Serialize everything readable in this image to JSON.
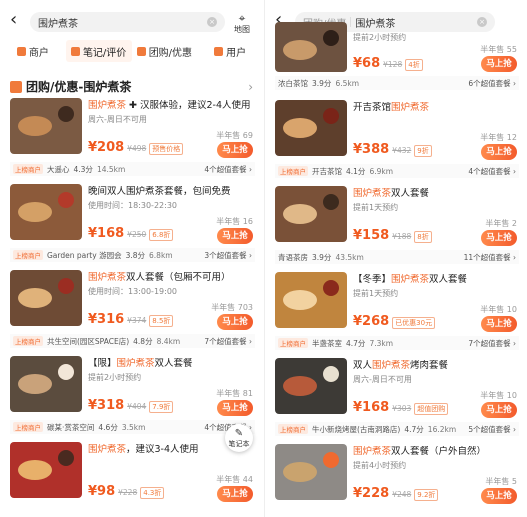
{
  "left": {
    "search": {
      "query": "围炉煮茶"
    },
    "map_label": "地图",
    "tabs": [
      {
        "label": "商户"
      },
      {
        "label": "笔记/评价"
      },
      {
        "label": "团购/优惠"
      },
      {
        "label": "用户"
      }
    ],
    "section_title": "团购/优惠-围炉煮茶",
    "cards": [
      {
        "title_hl": "围炉煮茶",
        "title_rest": " ✚ 汉服体验，建议2-4人使用",
        "sub": "周六-周日不可用",
        "sold": "半年售 69",
        "price": "¥208",
        "orig": "¥498",
        "disc": "预售价格",
        "shop": "大遥心",
        "rating": "4.3分",
        "dist": "14.5km",
        "more": "4个超值套餐 ›",
        "tag": "上榜商户",
        "buy": "马上抢"
      },
      {
        "title_hl": "",
        "title_rest": "晚间双人围炉煮茶套餐，包间免费",
        "sub": "使用时间：18:30-22:30",
        "sold": "半年售 16",
        "price": "¥168",
        "orig": "¥250",
        "disc": "6.8折",
        "shop": "Garden party 游园会",
        "rating": "3.8分",
        "dist": "6.8km",
        "more": "3个超值套餐 ›",
        "tag": "上榜商户",
        "buy": "马上抢"
      },
      {
        "title_hl": "围炉煮茶",
        "title_rest": "双人套餐（包厢不可用）",
        "sub": "使用时间：13:00-19:00",
        "sold": "半年售 703",
        "price": "¥316",
        "orig": "¥374",
        "disc": "8.5折",
        "shop": "共生空间(园区SPACE店)",
        "rating": "4.8分",
        "dist": "8.4km",
        "more": "7个超值套餐 ›",
        "tag": "上榜商户",
        "buy": "马上抢"
      },
      {
        "title_hl": "围炉煮茶",
        "title_rest": "双人套餐",
        "prefix": "【限】",
        "sub": "提前2小时预约",
        "sold": "半年售 81",
        "price": "¥318",
        "orig": "¥404",
        "disc": "7.9折",
        "shop": "碳某·赏茶空间",
        "rating": "4.6分",
        "dist": "3.5km",
        "more": "4个超值套餐 ›",
        "tag": "上榜商户",
        "buy": "马上抢"
      },
      {
        "title_hl": "围炉煮茶",
        "title_rest": "，建议3-4人使用",
        "sub": "",
        "sold": "半年售 44",
        "price": "¥98",
        "orig": "¥228",
        "disc": "4.3折",
        "shop": "",
        "rating": "",
        "dist": "",
        "more": "",
        "tag": "",
        "buy": "马上抢"
      }
    ],
    "float_btn": "笔记本"
  },
  "right": {
    "search": {
      "crumb": "团购/优惠",
      "query": "围炉煮茶"
    },
    "top_partial": {
      "sub": "提前2小时预约",
      "sold": "半年售 55",
      "price": "¥68",
      "orig": "¥128",
      "disc": "4折",
      "shop": "浓白茶馆",
      "rating": "3.9分",
      "dist": "6.5km",
      "more": "6个超值套餐 ›",
      "buy": "马上抢"
    },
    "cards": [
      {
        "title_hl": "围炉煮茶",
        "title_rest": "",
        "prefix": "开吉茶馆",
        "sub": "",
        "sold": "半年售 12",
        "price": "¥388",
        "orig": "¥432",
        "disc": "9折",
        "shop": "开吉茶馆",
        "rating": "4.1分",
        "dist": "6.9km",
        "more": "4个超值套餐 ›",
        "tag": "上榜商户",
        "buy": "马上抢"
      },
      {
        "title_hl": "围炉煮茶",
        "title_rest": "双人套餐",
        "sub": "提前1天预约",
        "sold": "半年售 2",
        "price": "¥158",
        "orig": "¥188",
        "disc": "8折",
        "shop": "青语茶房",
        "rating": "3.9分",
        "dist": "43.5km",
        "more": "11个超值套餐 ›",
        "tag": "",
        "buy": "马上抢"
      },
      {
        "title_hl": "围炉煮茶",
        "title_rest": "双人套餐",
        "prefix": "【冬季】",
        "sub": "提前1天预约",
        "sold": "半年售 10",
        "price": "¥268",
        "orig": "",
        "disc": "已优惠30元",
        "shop": "半盏茶室",
        "rating": "4.7分",
        "dist": "7.3km",
        "more": "7个超值套餐 ›",
        "tag": "上榜商户",
        "buy": "马上抢"
      },
      {
        "title_hl": "围炉煮茶",
        "title_rest": "烤肉套餐",
        "prefix": "双人",
        "sub": "周六-周日不可用",
        "sold": "半年售 10",
        "price": "¥168",
        "orig": "¥303",
        "disc": "超值团购",
        "shop": "牛小新烧烤屋(古南洞路店)",
        "rating": "4.7分",
        "dist": "16.2km",
        "more": "5个超值套餐 ›",
        "tag": "上榜商户",
        "buy": "马上抢"
      },
      {
        "title_hl": "围炉煮茶",
        "title_rest": "双人套餐（户外自然）",
        "sub": "提前4小时预约",
        "sold": "半年售 5",
        "price": "¥228",
        "orig": "¥248",
        "disc": "9.2折",
        "shop": "",
        "rating": "",
        "dist": "",
        "more": "",
        "tag": "",
        "buy": "马上抢"
      }
    ]
  },
  "colors": {
    "accent": "#f06a2f",
    "buy_start": "#ff8a4c",
    "buy_end": "#f35b2c"
  }
}
